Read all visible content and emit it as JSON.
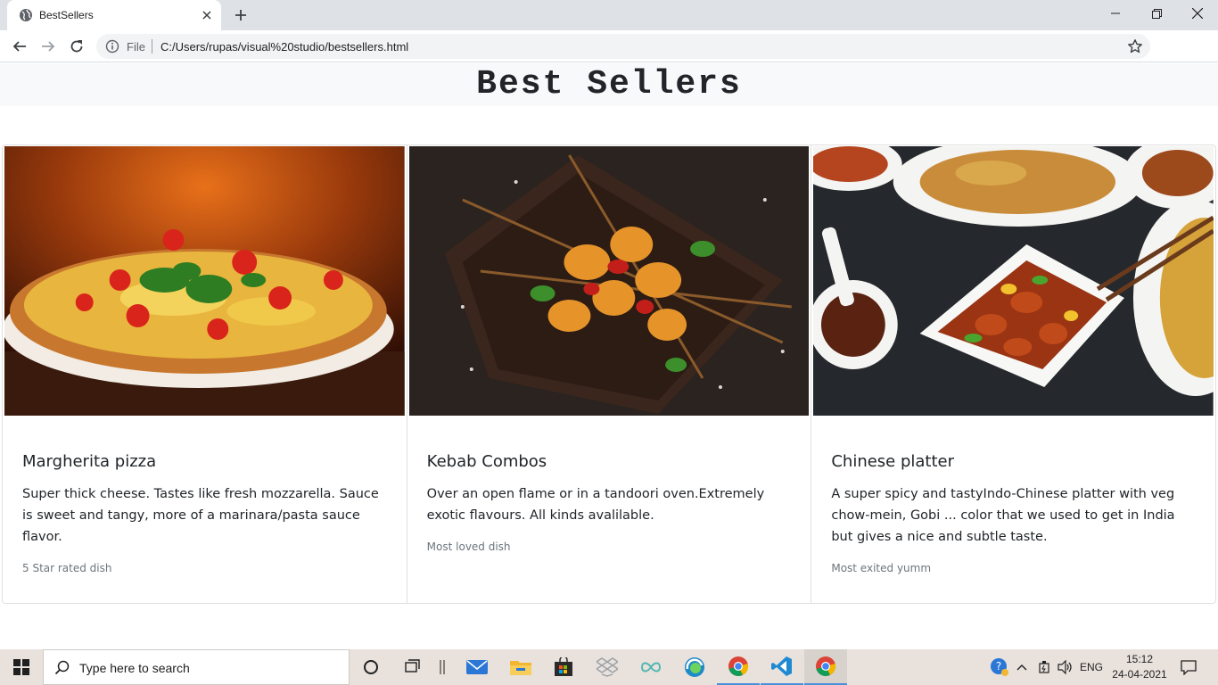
{
  "browser": {
    "tab_title": "BestSellers",
    "url_scheme": "File",
    "url": "C:/Users/rupas/visual%20studio/bestsellers.html"
  },
  "page": {
    "title": "Best Sellers",
    "cards": [
      {
        "title": "Margherita pizza",
        "text": "Super thick cheese. Tastes like fresh mozzarella. Sauce is sweet and tangy, more of a marinara/pasta sauce flavor.",
        "note": "5 Star rated dish"
      },
      {
        "title": "Kebab Combos",
        "text": "Over an open flame or in a tandoori oven.Extremely exotic flavours. All kinds avalilable.",
        "note": "Most loved dish"
      },
      {
        "title": "Chinese platter",
        "text": "A super spicy and tastyIndo-Chinese platter with veg chow-mein, Gobi ... color that we used to get in India but gives a nice and subtle taste.",
        "note": "Most exited yumm"
      }
    ]
  },
  "taskbar": {
    "search_placeholder": "Type here to search",
    "language": "ENG",
    "time": "15:12",
    "date": "24-04-2021"
  },
  "colors": {
    "tabbar": "#dee1e6",
    "heading_bar": "#f8f9fa",
    "muted_text": "#6c757d",
    "taskbar": "#e8e1dc"
  }
}
